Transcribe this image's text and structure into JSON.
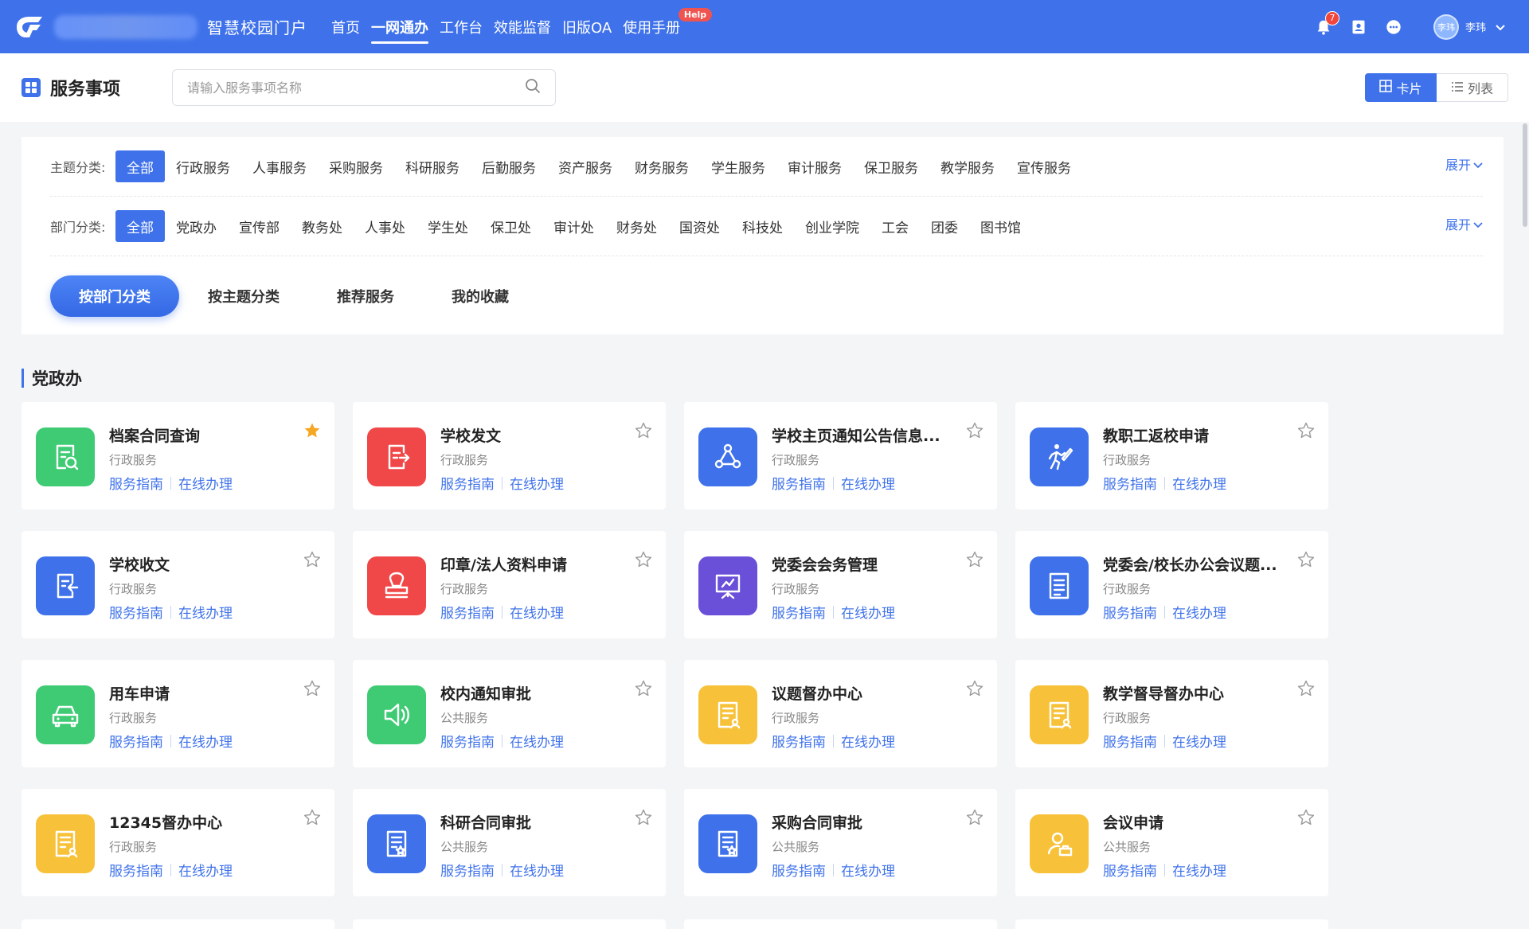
{
  "topbar": {
    "brand": "智慧校园门户",
    "nav": [
      "首页",
      "一网通办",
      "工作台",
      "效能监督",
      "旧版OA",
      "使用手册"
    ],
    "help_badge": "Help",
    "notification_count": "7",
    "user_avatar_text": "李玮",
    "user_name": "李玮"
  },
  "header": {
    "title": "服务事项",
    "search_placeholder": "请输入服务事项名称",
    "view_card": "卡片",
    "view_list": "列表"
  },
  "filters": {
    "topic_label": "主题分类:",
    "topic_items": [
      "全部",
      "行政服务",
      "人事服务",
      "采购服务",
      "科研服务",
      "后勤服务",
      "资产服务",
      "财务服务",
      "学生服务",
      "审计服务",
      "保卫服务",
      "教学服务",
      "宣传服务"
    ],
    "dept_label": "部门分类:",
    "dept_items": [
      "全部",
      "党政办",
      "宣传部",
      "教务处",
      "人事处",
      "学生处",
      "保卫处",
      "审计处",
      "财务处",
      "国资处",
      "科技处",
      "创业学院",
      "工会",
      "团委",
      "图书馆"
    ],
    "expand": "展开"
  },
  "tabs": [
    "按部门分类",
    "按主题分类",
    "推荐服务",
    "我的收藏"
  ],
  "section": {
    "title": "党政办",
    "link_guide": "服务指南",
    "link_online": "在线办理",
    "cards": [
      {
        "title": "档案合同查询",
        "category": "行政服务",
        "icon": "document-search-icon",
        "color": "#3ecb74",
        "starred": true
      },
      {
        "title": "学校发文",
        "category": "行政服务",
        "icon": "document-send-icon",
        "color": "#f04848",
        "starred": false
      },
      {
        "title": "学校主页通知公告信息...",
        "category": "行政服务",
        "icon": "share-nodes-icon",
        "color": "#3f72ea",
        "starred": false
      },
      {
        "title": "教职工返校申请",
        "category": "行政服务",
        "icon": "runner-icon",
        "color": "#3f72ea",
        "starred": false
      },
      {
        "title": "学校收文",
        "category": "行政服务",
        "icon": "document-receive-icon",
        "color": "#3f72ea",
        "starred": false
      },
      {
        "title": "印章/法人资料申请",
        "category": "行政服务",
        "icon": "stamp-icon",
        "color": "#f04848",
        "starred": false
      },
      {
        "title": "党委会会务管理",
        "category": "行政服务",
        "icon": "presentation-icon",
        "color": "#6a4fd8",
        "starred": false
      },
      {
        "title": "党委会/校长办公会议题...",
        "category": "行政服务",
        "icon": "list-document-icon",
        "color": "#3f72ea",
        "starred": false
      },
      {
        "title": "用车申请",
        "category": "行政服务",
        "icon": "car-icon",
        "color": "#3ecb74",
        "starred": false
      },
      {
        "title": "校内通知审批",
        "category": "公共服务",
        "icon": "speaker-icon",
        "color": "#3ecb74",
        "starred": false
      },
      {
        "title": "议题督办中心",
        "category": "行政服务",
        "icon": "form-document-icon",
        "color": "#f7c23a",
        "starred": false
      },
      {
        "title": "教学督导督办中心",
        "category": "行政服务",
        "icon": "form-document-icon",
        "color": "#f7c23a",
        "starred": false
      },
      {
        "title": "12345督办中心",
        "category": "行政服务",
        "icon": "form-document-icon",
        "color": "#f7c23a",
        "starred": false
      },
      {
        "title": "科研合同审批",
        "category": "公共服务",
        "icon": "contract-icon",
        "color": "#3f72ea",
        "starred": false
      },
      {
        "title": "采购合同审批",
        "category": "公共服务",
        "icon": "contract-icon",
        "color": "#3f72ea",
        "starred": false
      },
      {
        "title": "会议申请",
        "category": "公共服务",
        "icon": "meeting-user-icon",
        "color": "#f7c23a",
        "starred": false
      }
    ]
  }
}
